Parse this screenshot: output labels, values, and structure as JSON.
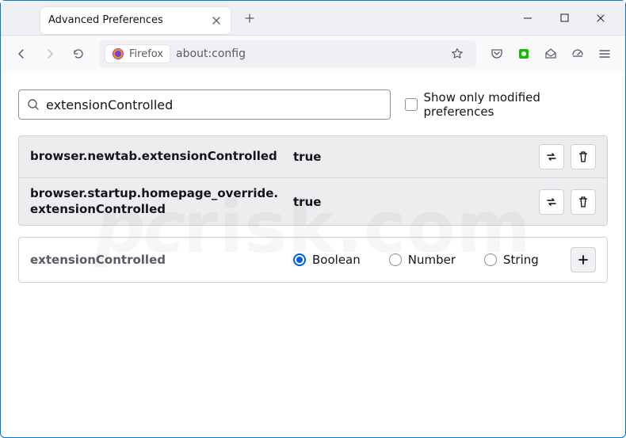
{
  "tab": {
    "title": "Advanced Preferences"
  },
  "urlbar": {
    "identity_label": "Firefox",
    "url": "about:config"
  },
  "search": {
    "value": "extensionControlled"
  },
  "show_modified_label": "Show only modified preferences",
  "prefs": [
    {
      "name": "browser.newtab.extensionControlled",
      "value": "true"
    },
    {
      "name": "browser.startup.homepage_override.extensionControlled",
      "value": "true"
    }
  ],
  "new_pref": {
    "name": "extensionControlled",
    "options": {
      "boolean": "Boolean",
      "number": "Number",
      "string": "String"
    }
  }
}
